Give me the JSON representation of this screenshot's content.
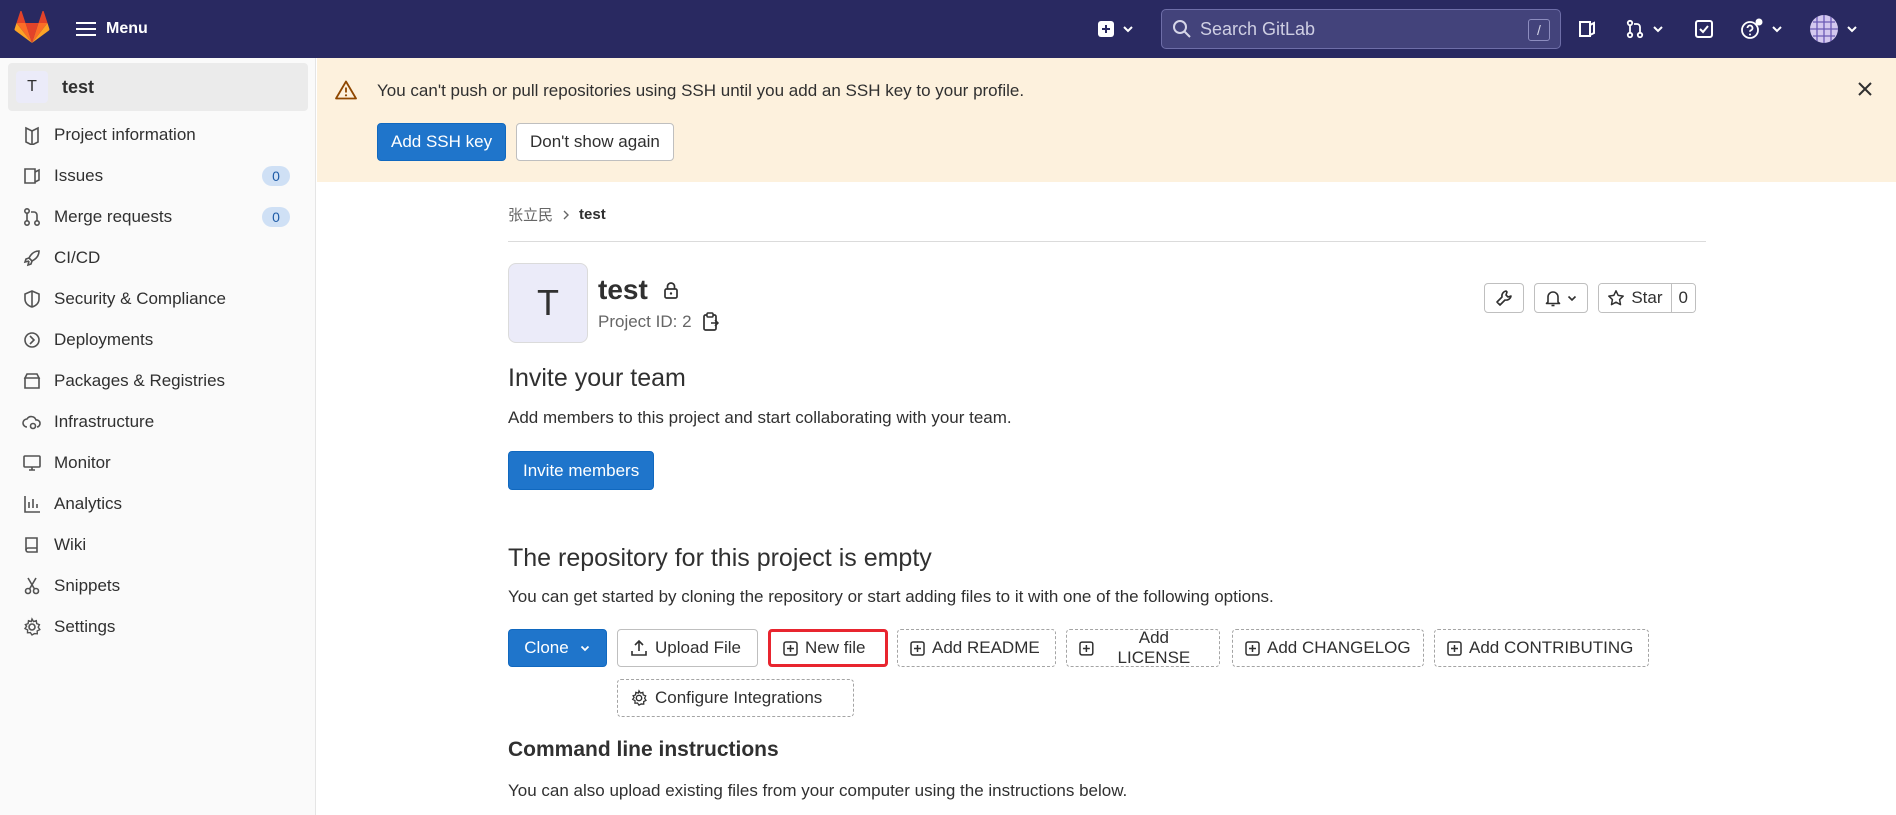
{
  "topbar": {
    "menu_label": "Menu",
    "search_placeholder": "Search GitLab",
    "search_shortcut": "/"
  },
  "sidebar": {
    "project_avatar_letter": "T",
    "project_name": "test",
    "items": [
      {
        "label": "Project information",
        "icon": "info-icon"
      },
      {
        "label": "Issues",
        "icon": "issues-icon",
        "badge": "0"
      },
      {
        "label": "Merge requests",
        "icon": "merge-request-icon",
        "badge": "0"
      },
      {
        "label": "CI/CD",
        "icon": "rocket-icon"
      },
      {
        "label": "Security & Compliance",
        "icon": "shield-icon"
      },
      {
        "label": "Deployments",
        "icon": "deployments-icon"
      },
      {
        "label": "Packages & Registries",
        "icon": "package-icon"
      },
      {
        "label": "Infrastructure",
        "icon": "cloud-gear-icon"
      },
      {
        "label": "Monitor",
        "icon": "monitor-icon"
      },
      {
        "label": "Analytics",
        "icon": "chart-icon"
      },
      {
        "label": "Wiki",
        "icon": "book-icon"
      },
      {
        "label": "Snippets",
        "icon": "snippet-icon"
      },
      {
        "label": "Settings",
        "icon": "gear-icon"
      }
    ]
  },
  "alert": {
    "message": "You can't push or pull repositories using SSH until you add an SSH key to your profile.",
    "add_key_label": "Add SSH key",
    "dismiss_label": "Don't show again"
  },
  "breadcrumb": {
    "parent": "张立民",
    "current": "test"
  },
  "project": {
    "avatar_letter": "T",
    "title": "test",
    "id_text": "Project ID: 2",
    "star_label": "Star",
    "star_count": "0"
  },
  "invite": {
    "heading": "Invite your team",
    "text": "Add members to this project and start collaborating with your team.",
    "button": "Invite members"
  },
  "empty_repo": {
    "heading": "The repository for this project is empty",
    "text": "You can get started by cloning the repository or start adding files to it with one of the following options.",
    "clone": "Clone",
    "upload_file": "Upload File",
    "new_file": "New file",
    "add_readme": "Add README",
    "add_license": "Add LICENSE",
    "add_changelog": "Add CHANGELOG",
    "add_contributing": "Add CONTRIBUTING",
    "configure_integrations": "Configure Integrations"
  },
  "cli": {
    "heading": "Command line instructions",
    "text": "You can also upload existing files from your computer using the instructions below."
  },
  "colors": {
    "topbar": "#292961",
    "primary": "#1f75cb",
    "alert_bg": "#fdf1dd",
    "highlight": "#e8252f"
  }
}
